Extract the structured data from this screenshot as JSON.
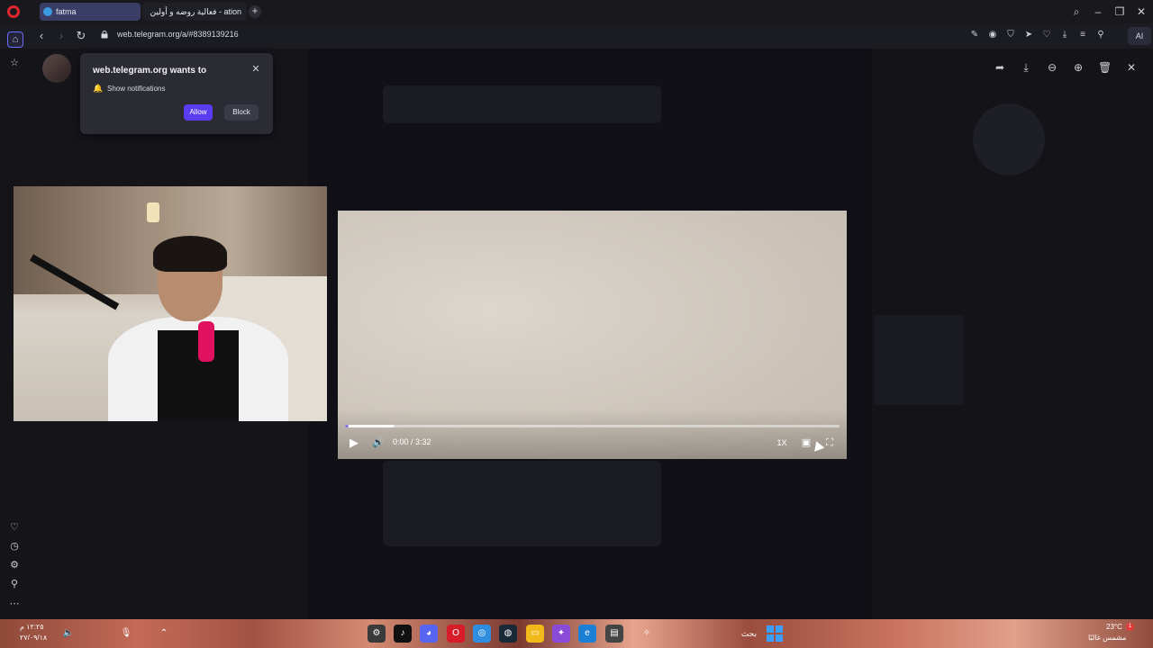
{
  "browser": {
    "tabs": [
      {
        "label": "fatma",
        "active": true
      },
      {
        "label": "ation - فعالية روضه و أولين",
        "active": false
      }
    ],
    "url": "web.telegram.org/a/#8389139216",
    "ai_label": "AI"
  },
  "notification": {
    "title": "web.telegram.org wants to",
    "permission": "Show notifications",
    "allow_label": "Allow",
    "block_label": "Block"
  },
  "video_player": {
    "time": "0:00 / 3:32",
    "speed": "1X",
    "progress_fraction": 0.0,
    "buffered_fraction": 0.1
  },
  "taskbar": {
    "time": "١٢:٢٥ م",
    "date": "٢٧/٠٩/١٨",
    "search_label": "بحث",
    "weather_temp": "23°C",
    "weather_desc": "مشمس غالبًا",
    "badge_count": "1"
  },
  "colors": {
    "accent": "#8774e1",
    "allow_button": "#5a3df0",
    "opera_red": "#e0262d"
  }
}
